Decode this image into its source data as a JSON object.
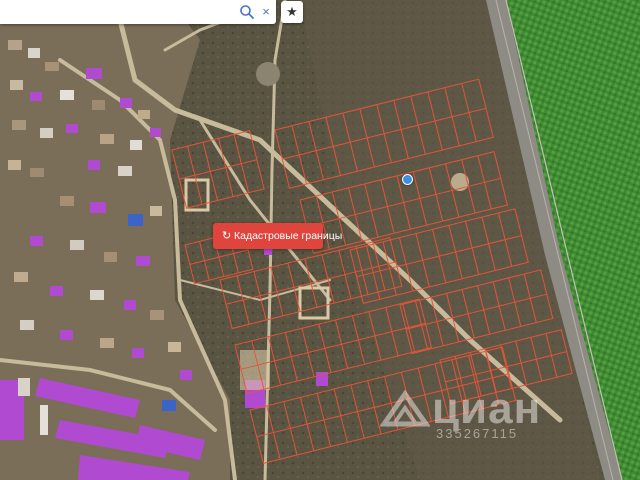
{
  "search": {
    "value": "",
    "placeholder": ""
  },
  "icons": {
    "search": "search-icon",
    "clear": "close-icon",
    "favorite": "star-icon",
    "refresh": "refresh-icon",
    "logo": "cian-logo-icon"
  },
  "toolbar": {
    "clear_glyph": "×",
    "favorite_glyph": "★"
  },
  "cadastral_button": {
    "icon_glyph": "↻",
    "label": "Кадастровые границы"
  },
  "watermark": {
    "brand": "циан",
    "listing_code": "335267115"
  },
  "colors": {
    "parcel_lines": "#e8553a",
    "cadastral_button": "#e0453d",
    "marker": "#3f8fe0",
    "field": "#3f8a33",
    "purple_roofs": "#b04ad0"
  }
}
